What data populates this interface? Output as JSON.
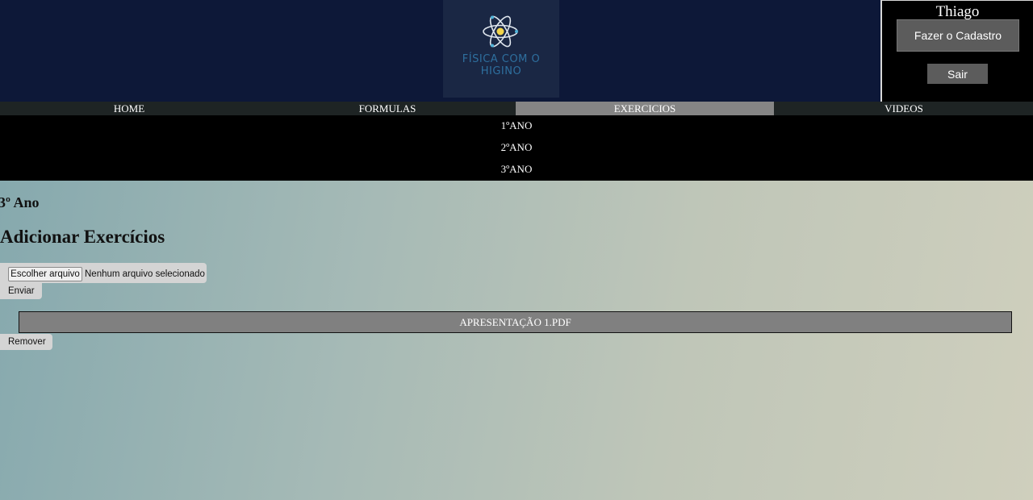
{
  "header": {
    "logo_text_line1": "FÍSICA COM O",
    "logo_text_line2": "HIGINO",
    "logo_icon": "atom-icon"
  },
  "user": {
    "name": "Thiago",
    "register_label": "Fazer o Cadastro",
    "logout_label": "Sair"
  },
  "nav": {
    "items": [
      {
        "label": "HOME"
      },
      {
        "label": "FORMULAS"
      },
      {
        "label": "EXERCICIOS",
        "active": true
      },
      {
        "label": "VIDEOS"
      }
    ]
  },
  "submenu": {
    "items": [
      "1ºANO",
      "2ºANO",
      "3ºANO"
    ]
  },
  "main": {
    "year_heading": "3º Ano",
    "add_heading": "Adicionar Exercícios",
    "file_input": {
      "button_label": "Escolher arquivo",
      "status": "Nenhum arquivo selecionado"
    },
    "send_label": "Enviar",
    "files": [
      "APRESENTAÇÃO 1.PDF"
    ],
    "remove_label": "Remover"
  },
  "colors": {
    "header_bg": "#0d1838",
    "nav_bg": "#1e2424",
    "nav_active": "#858585",
    "submenu_bg": "#000000",
    "file_row_bg": "#808080"
  }
}
